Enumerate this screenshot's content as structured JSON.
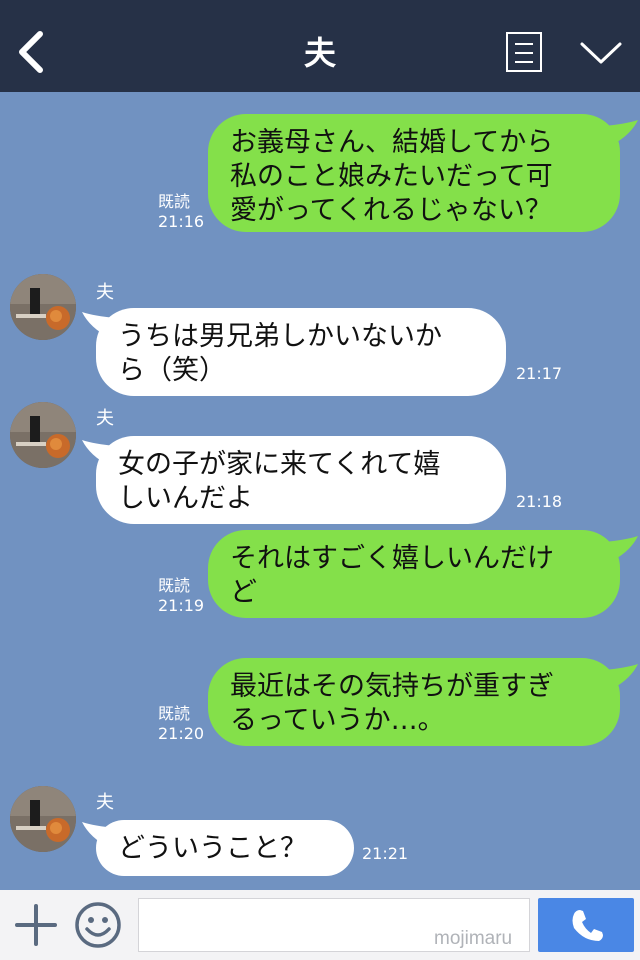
{
  "header": {
    "title": "夫",
    "back_icon": "chevron-left-icon",
    "menu_icon": "list-menu-icon",
    "collapse_icon": "chevron-down-icon"
  },
  "messages": [
    {
      "direction": "out",
      "lines": [
        "お義母さん、結婚してから",
        "私のこと娘みたいだって可",
        "愛がってくれるじゃない？"
      ],
      "read_label": "既読",
      "time": "21:16"
    },
    {
      "direction": "in",
      "sender": "夫",
      "lines": [
        "うちは男兄弟しかいないか",
        "ら（笑）"
      ],
      "time": "21:17"
    },
    {
      "direction": "in",
      "sender": "夫",
      "lines": [
        "女の子が家に来てくれて嬉",
        "しいんだよ"
      ],
      "time": "21:18"
    },
    {
      "direction": "out",
      "lines": [
        "それはすごく嬉しいんだけ",
        "ど"
      ],
      "read_label": "既読",
      "time": "21:19"
    },
    {
      "direction": "out",
      "lines": [
        "最近はその気持ちが重すぎ",
        "るっていうか…。"
      ],
      "read_label": "既読",
      "time": "21:20"
    },
    {
      "direction": "in",
      "sender": "夫",
      "lines": [
        "どういうこと？"
      ],
      "time": "21:21"
    }
  ],
  "footer": {
    "input_value": "",
    "watermark": "mojimaru",
    "plus_icon": "plus-icon",
    "emoji_icon": "smiley-icon",
    "call_icon": "phone-icon"
  },
  "colors": {
    "header_bg": "#263147",
    "chat_bg": "#7192c1",
    "outgoing_bubble": "#84e04a",
    "incoming_bubble": "#ffffff",
    "call_button": "#4a87e5"
  }
}
